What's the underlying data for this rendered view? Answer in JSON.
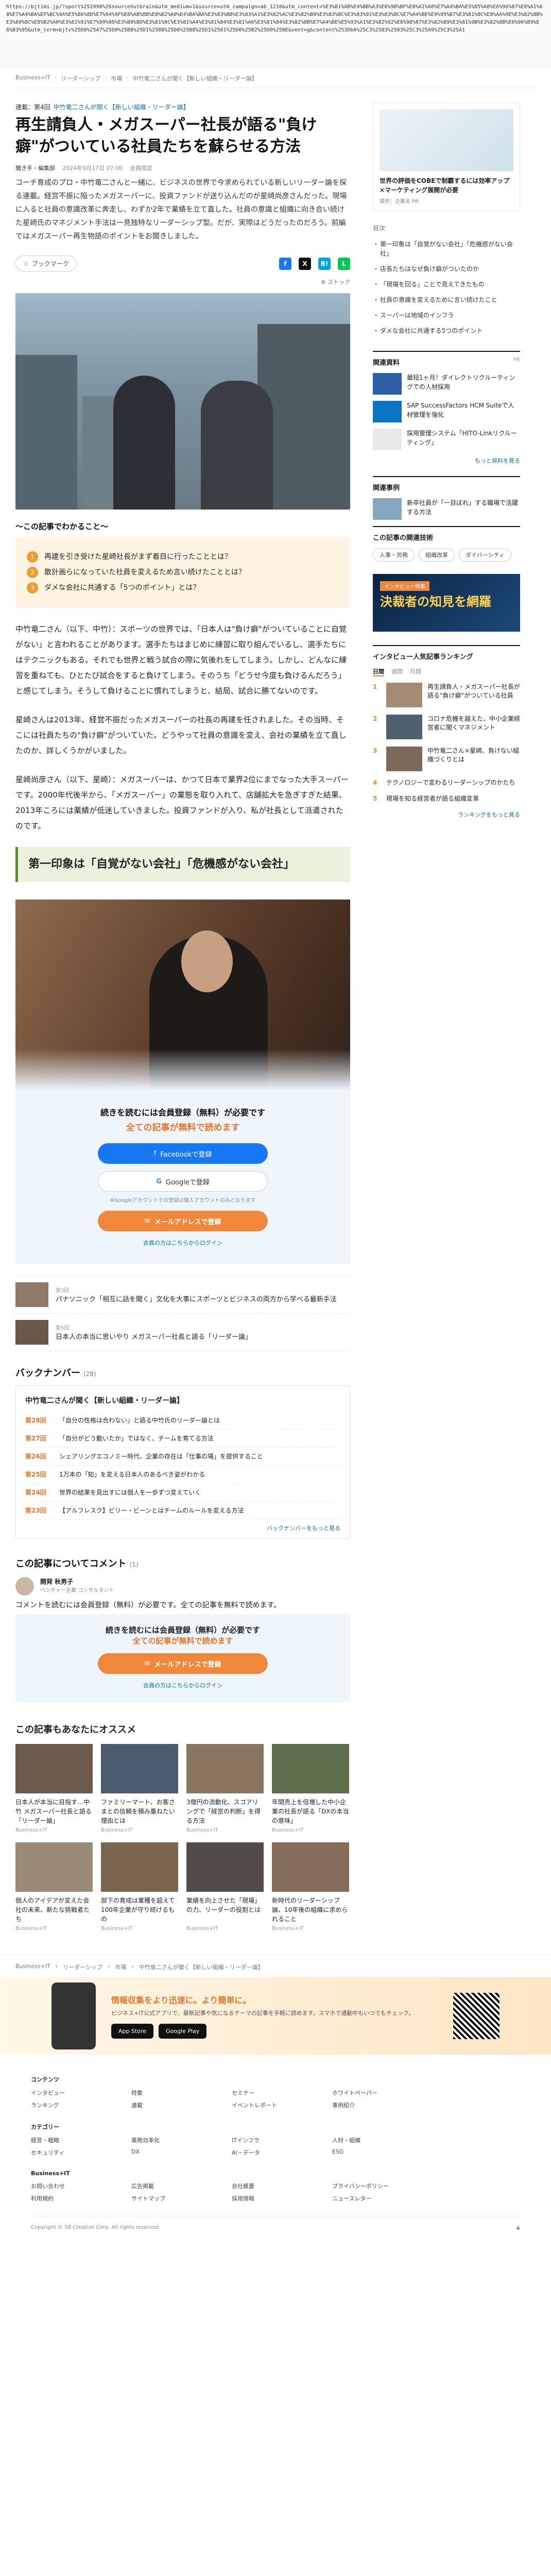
{
  "url": "https://bjtimi.jp/?sport%252098%26sourceOutbrain&utm_medium=1&source=utm_campaign=ab_1210&utm_content=%E3%81%AB%E4%BB%A3%E6%9B%BF%E8%A1%A8%E7%A4%BA%E5%85%A8%E6%96%87%E8%A1%A8%E7%A4%BA%EF%BC%9A%E5%86%8D%E7%94%9F%E8%AB%8B%E8%B2%A0%E4%BA%BA%E3%83%BB%E3%83%A1%E3%82%AC%E3%82%B9%E3%83%BC%E3%83%91%E3%83%BC%E7%A4%BE%E9%95%B7%E3%81%8C%E8%AA%9E%E3%82%8B%E3%80%8C%E8%B2%A0%E3%81%91%E7%99%96%E3%80%8D%E3%81%8C%E3%81%A4%E3%81%84%E3%81%A6%E3%81%84%E3%82%8B%E7%A4%BE%E5%93%A1%E3%82%92%E8%98%87%E3%82%89%E3%81%9B%E3%82%8B%E6%96%B9%E6%B3%95&utm_term=bjtv%25D0%25A7%25D0%25B8%25D1%2588%25D0%25B8%25D1%2581%25D0%25B2%25D0%25BE&vent=g&content%253DbA%25C3%2583%2583%25C3%25A9%25C3%25A1",
  "breadcrumb": [
    "Business+IT",
    "リーダーシップ",
    "市場",
    "中竹竜二さんが聞く【新しい組織・リーダー論】"
  ],
  "article": {
    "series": "中竹竜二さんが聞く【新しい組織・リーダー論】",
    "series_prefix": "連載：第4回",
    "title": "再生請負人・メガスーパー社長が語る\"負け癖\"がついている社員たちを蘇らせる方法",
    "author": "聞き手・編集部",
    "date": "2024年9月17日 07:00",
    "views": "会員限定",
    "lead": "コーチ育成のプロ・中竹竜二さんと一緒に、ビジネスの世界で今求められている新しいリーダー論を探る連載。経営不振に陥ったメガスーパーに、投資ファンドが送り込んだのが星崎尚彦さんだった。現場に入ると社員の意識改革に奔走し、わずか2年で業績を立て直した。社員の意識と組織に向き合い続けた星崎氏のマネジメント手法は一見独特なリーダーシップ型。だが、実際はどうだったのだろう。前編ではメガスーパー再生物語のポイントをお聞きしました。",
    "bookmark": "ブックマーク",
    "bookmark_count": "Bookmark",
    "save_label": "ストック",
    "takeaway_title": "この記事でわかること",
    "takeaways": [
      "再建を引き受けた星崎社長がまず着目に行ったこととは？",
      "散計画らになっていた社員を変えるため言い続けたこととは？",
      "ダメな会社に共通する「5つのポイント」とは？"
    ],
    "paragraphs": [
      "中竹竜二さん（以下、中竹）：スポーツの世界では、「日本人は\"負け癖\"がついていることに自覚がない」と言われることがあります。選手たちはまじめに練習に取り組んでいるし、選手たちにはテクニックもある。それでも世界と戦う試合の際に気後れをしてしまう。しかし、どんなに練習を重ねても、ひとたび試合をすると負けてしまう。そのうち「どうせ今度も負けるんだろう」と感じてしまう。そうして負けることに慣れてしまうと、結局、試合に勝てないのです。",
      "星崎さんは2013年、経営不振だったメガスーパーの社長の再建を任されました。その当時、そこには社員たちの\"負け癖\"がついていた。どうやって社員の意識を変え、会社の業績を立て直したのか、詳しくうかがいました。",
      "星崎尚彦さん（以下、星崎）：メガスーパーは、かつて日本で業界2位にまでなった大手スーパーです。2000年代後半から、「メガスーパー」の業態を取り入れて、店舗拡大を急ぎすぎた結果、2013年ころには業績が低迷していきました。投資ファンドが入り、私が社長として派遣されたのです。"
    ],
    "h2": "第一印象は「自覚がない会社」「危機感がない会社」",
    "gate_title": "続きを読むには会員登録（無料）が必要です",
    "gate_sub": "全ての記事が無料で読めます",
    "gate_fb": "Facebookで登録",
    "gate_google": "Googleで登録",
    "gate_note": "※Googleアカウントでの登録は個人アカウントのみとなります",
    "gate_mail": "メールアドレスで登録",
    "gate_login": "会員の方はこちらからログイン",
    "related": [
      {
        "label": "第3回",
        "title": "パナソニック「相互に話を聞く」文化を大事にスポーツとビジネスの両方から学べる最新手法"
      },
      {
        "label": "第5回",
        "title": "日本人の本当に思いやり メガスーパー社長と語る「リーダー論」"
      }
    ]
  },
  "backnumber": {
    "title": "バックナンバー",
    "count": "(28)",
    "head": "中竹竜二さんが聞く【新しい組織・リーダー論】",
    "items": [
      {
        "no": "第28回",
        "title": "「自分の性格は合わない」と語る中竹氏のリーダー論とは"
      },
      {
        "no": "第27回",
        "title": "「自分がどう動いたか」ではなく、チームを育てる方法"
      },
      {
        "no": "第26回",
        "title": "シェアリングエコノミー時代、企業の存在は「仕事の場」を提供すること"
      },
      {
        "no": "第25回",
        "title": "1万本の「知」を変える日本人のあるべき姿がわかる"
      },
      {
        "no": "第24回",
        "title": "世界の結果を見出すには個人を一歩ずつ変えていく"
      },
      {
        "no": "第23回",
        "title": "【アルフレスク】ビリー・ビーンとはチームのルールを変える方法"
      }
    ],
    "more": "バックナンバーをもっと見る"
  },
  "comments": {
    "title": "この記事についてコメント",
    "count": "(1)",
    "name": "開発 秋男子",
    "role": "ベンチャー企業 コンサルタント",
    "text": "コメントを読むには会員登録（無料）が必要です。全ての記事を無料で読めます。",
    "gate_title": "続きを読むには会員登録（無料）が必要です",
    "gate_sub": "全ての記事が無料で読めます",
    "gate_mail": "メールアドレスで登録",
    "gate_login": "会員の方はこちらからログイン"
  },
  "recommend": {
    "title": "この記事もあなたにオススメ",
    "cards": [
      {
        "t": "日本人が本当に目指す…中竹 メガスーパー社長と語る「リーダー論」",
        "src": "Business+IT",
        "c": "#6d5a4a"
      },
      {
        "t": "ファミリーマート、お客さまとの信頼を積み重ねたい理由とは",
        "src": "Business+IT",
        "c": "#4a5c6e"
      },
      {
        "t": "3億円の流動化、スコアリングで「経営の判断」を得る方法",
        "src": "Business+IT",
        "c": "#8a7560"
      },
      {
        "t": "年間売上を倍増した中小企業の社長が語る「DXの本当の意味」",
        "src": "Business+IT",
        "c": "#5e6f4e"
      },
      {
        "t": "個人のアイデアが変えた会社の未来、新たな挑戦者たち",
        "src": "Business+IT",
        "c": "#9a8a78"
      },
      {
        "t": "部下の育成は業種を超えて100年企業が守り続けるもの",
        "src": "Business+IT",
        "c": "#7a6550"
      },
      {
        "t": "業績を向上させた「現場」の力、リーダーの役割とは",
        "src": "Business+IT",
        "c": "#524b48"
      },
      {
        "t": "新時代のリーダーシップ論、10年後の組織に求められること",
        "src": "Business+IT",
        "c": "#866d5b"
      }
    ]
  },
  "sidebar": {
    "ad_title": "世界の評価をCOBEで制覇するには効率アップ×マーケティング展開が必要",
    "ad_sub": "提供：企業名 PR",
    "toc_head": "目次",
    "toc": [
      "第一印象は「自覚がない会社」「危機感がない会社」",
      "店長たちはなぜ負け癖がついたのか",
      "「現場を回る」ことで見えてきたもの",
      "社員の意識を変えるために言い続けたこと",
      "スーパーは地域のインフラ",
      "ダメな会社に共通する5つのポイント"
    ],
    "related_title": "関連資料",
    "related_pr": "PR",
    "related": [
      {
        "t": "最短1ヶ月！ダイレクトリクルーティングでの人材採用"
      },
      {
        "t": "SAP SuccessFactors HCM Suiteで人材管理を強化"
      },
      {
        "t": "採用管理システム「HITO-Linkリクルーティング」"
      }
    ],
    "related_more": "もっと資料を見る",
    "rel_article_title": "関連事例",
    "rel_article": "新卒社員が「一目ぼれ」する職場で活躍する方法",
    "tags_title": "この記事の関連技術",
    "tags": [
      "人事・労務",
      "組織改革",
      "ダイバーシティ"
    ],
    "banner_label": "インタビュー特集",
    "banner_text": "決裁者の知見を網羅",
    "rank_title": "インタビュー人気記事ランキング",
    "rank_tabs": [
      "日間",
      "週間",
      "月間"
    ],
    "rank": [
      {
        "n": "1",
        "t": "再生請負人・メガスーパー社長が語る\"負け癖\"がついている社員"
      },
      {
        "n": "2",
        "t": "コロナ危機を越えた、中小企業経営者に聞くマネジメント"
      },
      {
        "n": "3",
        "t": "中竹竜二さん×星崎、負けない組織づくりとは"
      },
      {
        "n": "4",
        "t": "テクノロジーで変わるリーダーシップのかたち"
      },
      {
        "n": "5",
        "t": "現場を知る経営者が語る組織変革"
      }
    ],
    "rank_more": "ランキングをもっと見る"
  },
  "footer": {
    "crumb": [
      "Business+IT",
      "リーダーシップ",
      "市場",
      "中竹竜二さんが聞く【新しい組織・リーダー論】"
    ],
    "app_title": "情報収集をより迅速に。より簡単に。",
    "app_desc": "ビジネス+IT公式アプリで、最新記事や気になるテーマの記事を手軽に読めます。スマホで通勤中もいつでもチェック。",
    "app_store": "App Store",
    "play_store": "Google Play",
    "groups": [
      {
        "h": "コンテンツ",
        "items": [
          "インタビュー",
          "特集",
          "セミナー",
          "ホワイトペーパー",
          "ランキング",
          "連載",
          "イベントレポート",
          "事例紹介"
        ]
      },
      {
        "h": "カテゴリー",
        "items": [
          "経営・戦略",
          "業務効率化",
          "ITインフラ",
          "人材・組織",
          "セキュリティ",
          "DX",
          "AI・データ",
          "ESG"
        ]
      },
      {
        "h": "Business+IT",
        "items": [
          "お問い合わせ",
          "広告掲載",
          "会社概要",
          "プライバシーポリシー",
          "利用規約",
          "サイトマップ",
          "採用情報",
          "ニュースレター"
        ]
      }
    ],
    "copyright": "Copyright © SB Creative Corp. All rights reserved."
  }
}
